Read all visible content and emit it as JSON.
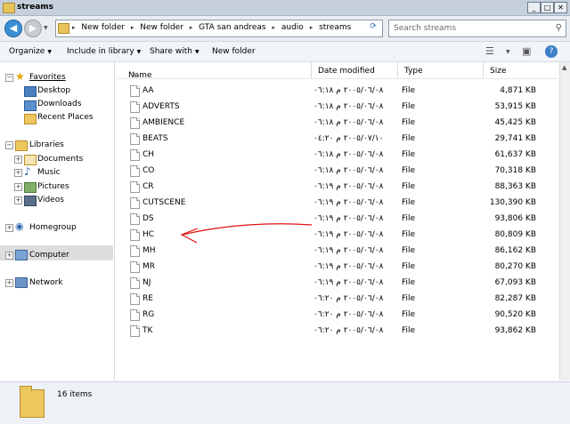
{
  "window": {
    "title": "streams"
  },
  "address": {
    "crumbs": [
      "New folder",
      "New folder",
      "GTA san andreas",
      "audio",
      "streams"
    ]
  },
  "search": {
    "placeholder": "Search streams"
  },
  "toolbar": {
    "organize": "Organize",
    "include": "Include in library",
    "share": "Share with",
    "new_folder": "New folder"
  },
  "sidebar": {
    "favorites": "Favorites",
    "desktop": "Desktop",
    "downloads": "Downloads",
    "recent": "Recent Places",
    "libraries": "Libraries",
    "documents": "Documents",
    "music": "Music",
    "pictures": "Pictures",
    "videos": "Videos",
    "homegroup": "Homegroup",
    "computer": "Computer",
    "network": "Network"
  },
  "columns": {
    "name": "Name",
    "date": "Date modified",
    "type": "Type",
    "size": "Size"
  },
  "files": [
    {
      "name": "AA",
      "date": "٢٠٠٥/٠٦/٠٨ م ٠٦:١٨",
      "type": "File",
      "size": "4,871 KB"
    },
    {
      "name": "ADVERTS",
      "date": "٢٠٠٥/٠٦/٠٨ م ٠٦:١٨",
      "type": "File",
      "size": "53,915 KB"
    },
    {
      "name": "AMBIENCE",
      "date": "٢٠٠٥/٠٦/٠٨ م ٠٦:١٨",
      "type": "File",
      "size": "45,425 KB"
    },
    {
      "name": "BEATS",
      "date": "٢٠٠٥/٠٧/١٠ م ٠٤:٢٠",
      "type": "File",
      "size": "29,741 KB"
    },
    {
      "name": "CH",
      "date": "٢٠٠٥/٠٦/٠٨ م ٠٦:١٨",
      "type": "File",
      "size": "61,637 KB"
    },
    {
      "name": "CO",
      "date": "٢٠٠٥/٠٦/٠٨ م ٠٦:١٨",
      "type": "File",
      "size": "70,318 KB"
    },
    {
      "name": "CR",
      "date": "٢٠٠٥/٠٦/٠٨ م ٠٦:١٩",
      "type": "File",
      "size": "88,363 KB"
    },
    {
      "name": "CUTSCENE",
      "date": "٢٠٠٥/٠٦/٠٨ م ٠٦:١٩",
      "type": "File",
      "size": "130,390 KB"
    },
    {
      "name": "DS",
      "date": "٢٠٠٥/٠٦/٠٨ م ٠٦:١٩",
      "type": "File",
      "size": "93,806 KB"
    },
    {
      "name": "HC",
      "date": "٢٠٠٥/٠٦/٠٨ م ٠٦:١٩",
      "type": "File",
      "size": "80,809 KB"
    },
    {
      "name": "MH",
      "date": "٢٠٠٥/٠٦/٠٨ م ٠٦:١٩",
      "type": "File",
      "size": "86,162 KB"
    },
    {
      "name": "MR",
      "date": "٢٠٠٥/٠٦/٠٨ م ٠٦:١٩",
      "type": "File",
      "size": "80,270 KB"
    },
    {
      "name": "NJ",
      "date": "٢٠٠٥/٠٦/٠٨ م ٠٦:١٩",
      "type": "File",
      "size": "67,093 KB"
    },
    {
      "name": "RE",
      "date": "٢٠٠٥/٠٦/٠٨ م ٠٦:٢٠",
      "type": "File",
      "size": "82,287 KB"
    },
    {
      "name": "RG",
      "date": "٢٠٠٥/٠٦/٠٨ م ٠٦:٢٠",
      "type": "File",
      "size": "90,520 KB"
    },
    {
      "name": "TK",
      "date": "٢٠٠٥/٠٦/٠٨ م ٠٦:٢٠",
      "type": "File",
      "size": "93,862 KB"
    }
  ],
  "status": {
    "count": "16 items"
  },
  "colors": {
    "annotation_arrow": "#e01010",
    "selected_bg": "#dddddd",
    "folder": "#ecc85e"
  }
}
